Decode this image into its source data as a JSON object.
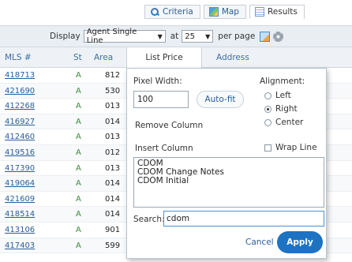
{
  "tabs": [
    {
      "label": "Criteria",
      "icon": "search-icon"
    },
    {
      "label": "Map",
      "icon": "map-icon"
    },
    {
      "label": "Results",
      "icon": "results-icon",
      "active": true
    }
  ],
  "display_bar": {
    "display_label": "Display",
    "display_value": "Agent Single Line",
    "at_label": "at",
    "per_page_value": "25",
    "per_page_label": "per page"
  },
  "grid": {
    "headers": {
      "mls": "MLS #",
      "st": "St",
      "area": "Area",
      "price": "List Price",
      "address": "Address"
    },
    "rows": [
      {
        "mls": "418713",
        "st": "A",
        "area": "812"
      },
      {
        "mls": "421690",
        "st": "A",
        "area": "530"
      },
      {
        "mls": "412268",
        "st": "A",
        "area": "013"
      },
      {
        "mls": "416927",
        "st": "A",
        "area": "014"
      },
      {
        "mls": "412460",
        "st": "A",
        "area": "013"
      },
      {
        "mls": "419516",
        "st": "A",
        "area": "012"
      },
      {
        "mls": "417390",
        "st": "A",
        "area": "013"
      },
      {
        "mls": "419064",
        "st": "A",
        "area": "014"
      },
      {
        "mls": "421609",
        "st": "A",
        "area": "014"
      },
      {
        "mls": "418514",
        "st": "A",
        "area": "014"
      },
      {
        "mls": "413106",
        "st": "A",
        "area": "901"
      },
      {
        "mls": "417403",
        "st": "A",
        "area": "599"
      }
    ]
  },
  "column_popup": {
    "pixel_width_label": "Pixel Width:",
    "pixel_width_value": "100",
    "autofit_label": "Auto-fit",
    "alignment_label": "Alignment:",
    "alignment_options": [
      "Left",
      "Right",
      "Center"
    ],
    "alignment_selected": "Right",
    "remove_column_label": "Remove Column",
    "insert_column_label": "Insert Column",
    "wrap_line_label": "Wrap Line",
    "insert_options": [
      "CDOM",
      "CDOM Change Notes",
      "CDOM Initial"
    ],
    "search_label": "Search:",
    "search_value": "cdom",
    "cancel_label": "Cancel",
    "apply_label": "Apply"
  },
  "colors": {
    "link": "#2a5d9a",
    "apply_button": "#1d72c2",
    "status_active": "#3a8a3a"
  }
}
